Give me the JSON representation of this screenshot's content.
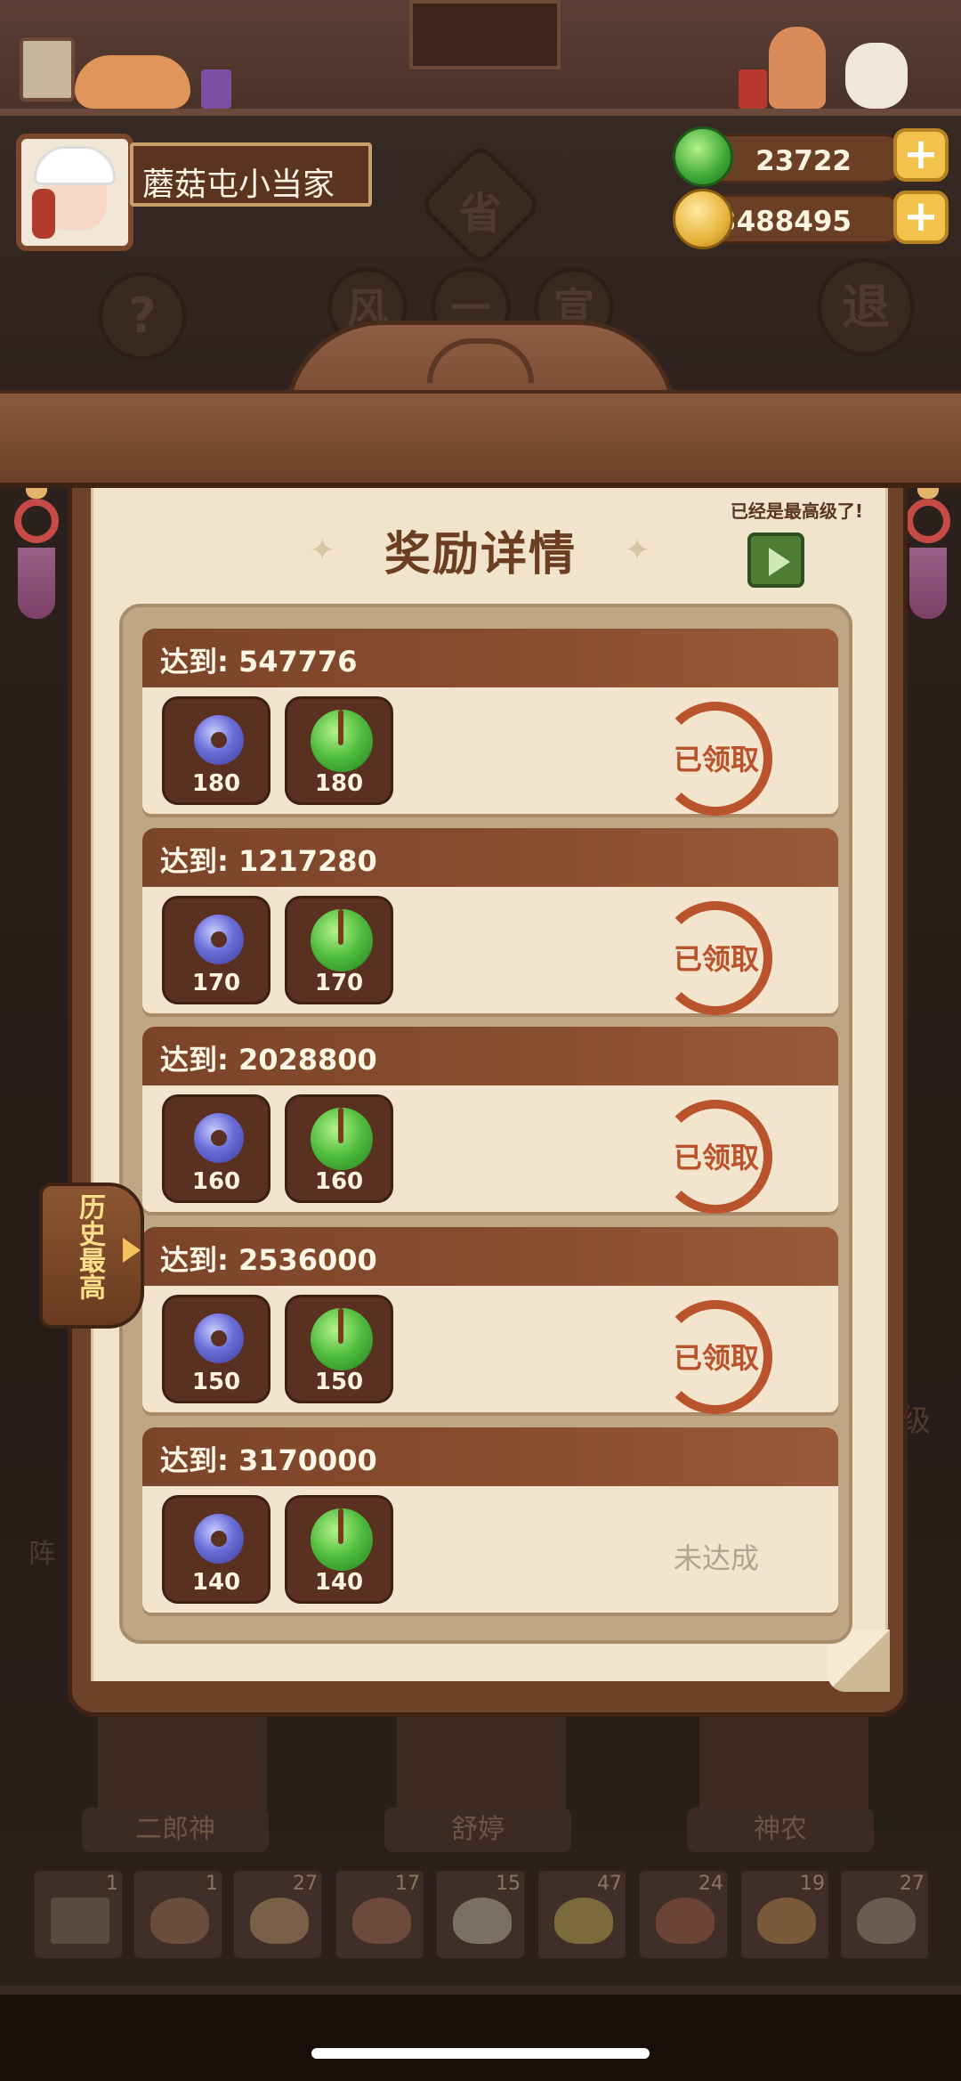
{
  "player": {
    "name": "蘑菇屯小当家",
    "jade": "23722",
    "coins": "43488495"
  },
  "background": {
    "buttons": [
      "省",
      "风",
      "一",
      "宣",
      "退"
    ],
    "help": "?",
    "side_letters": [
      "级",
      "阵"
    ]
  },
  "dialog": {
    "title": "奖励详情",
    "max_level_note": "已经是最高级了!",
    "reach_prefix": "达到:",
    "rewards": [
      {
        "threshold": "547776",
        "blue": "180",
        "green": "180",
        "status": "已领取"
      },
      {
        "threshold": "1217280",
        "blue": "170",
        "green": "170",
        "status": "已领取"
      },
      {
        "threshold": "2028800",
        "blue": "160",
        "green": "160",
        "status": "已领取"
      },
      {
        "threshold": "2536000",
        "blue": "150",
        "green": "150",
        "status": "已领取"
      },
      {
        "threshold": "3170000",
        "blue": "140",
        "green": "140",
        "status": "未达成"
      }
    ]
  },
  "side_tab": {
    "label": "历史最高"
  },
  "characters": [
    "二郎神",
    "舒婷",
    "神农"
  ],
  "inventory": [
    "1",
    "1",
    "27",
    "17",
    "15",
    "47",
    "24",
    "19",
    "27"
  ],
  "colors": {
    "stamp": "#b8532b",
    "header": "#7b4429",
    "paper": "#f1e3cc"
  }
}
